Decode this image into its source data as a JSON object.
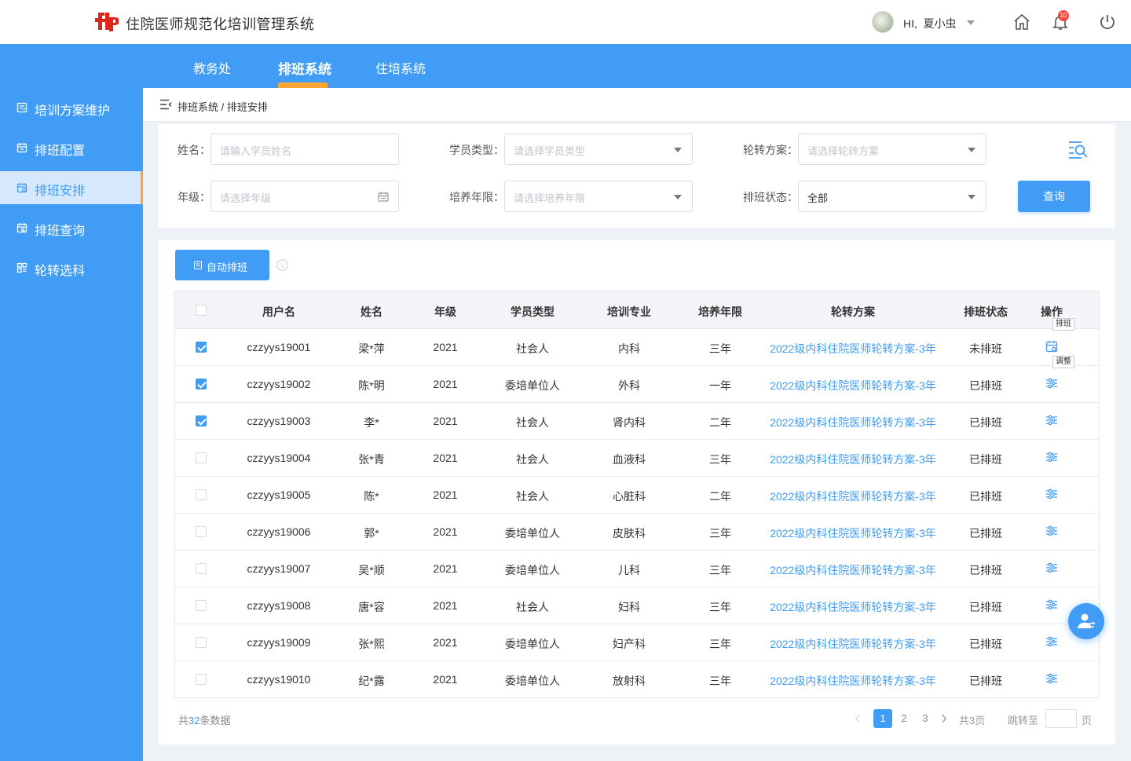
{
  "header": {
    "app_title": "住院医师规范化培训管理系统",
    "greeting": "HI,",
    "username": "夏小虫",
    "notification_count": "10"
  },
  "top_nav": [
    {
      "label": "教务处",
      "active": false
    },
    {
      "label": "排班系统",
      "active": true
    },
    {
      "label": "住培系统",
      "active": false
    }
  ],
  "sidebar": [
    {
      "label": "培训方案维护",
      "icon": "document-icon",
      "active": false
    },
    {
      "label": "排班配置",
      "icon": "calendar-config-icon",
      "active": false
    },
    {
      "label": "排班安排",
      "icon": "calendar-icon",
      "active": true
    },
    {
      "label": "排班查询",
      "icon": "calendar-search-icon",
      "active": false
    },
    {
      "label": "轮转选科",
      "icon": "grid-icon",
      "active": false
    }
  ],
  "breadcrumb": "排班系统 / 排班安排",
  "filters": {
    "name": {
      "label": "姓名：",
      "placeholder": "请输入学员姓名"
    },
    "student_type": {
      "label": "学员类型：",
      "placeholder": "请选择学员类型"
    },
    "rotation_plan": {
      "label": "轮转方案：",
      "placeholder": "请选择轮转方案"
    },
    "grade": {
      "label": "年级：",
      "placeholder": "请选择年级"
    },
    "training_years": {
      "label": "培养年限：",
      "placeholder": "请选择培养年限"
    },
    "schedule_status": {
      "label": "排班状态：",
      "value": "全部"
    },
    "query_label": "查询"
  },
  "toolbar": {
    "auto_schedule_label": "自动排班"
  },
  "table": {
    "columns": [
      "用户名",
      "姓名",
      "年级",
      "学员类型",
      "培训专业",
      "培养年限",
      "轮转方案",
      "排班状态",
      "操作"
    ],
    "rows": [
      {
        "checked": true,
        "username": "czzyys19001",
        "name": "梁*萍",
        "grade": "2021",
        "type": "社会人",
        "major": "内科",
        "years": "三年",
        "plan": "2022级内科住院医师轮转方案-3年",
        "status": "未排班",
        "action": "schedule"
      },
      {
        "checked": true,
        "username": "czzyys19002",
        "name": "陈*明",
        "grade": "2021",
        "type": "委培单位人",
        "major": "外科",
        "years": "一年",
        "plan": "2022级内科住院医师轮转方案-3年",
        "status": "已排班",
        "action": "adjust"
      },
      {
        "checked": true,
        "username": "czzyys19003",
        "name": "李*",
        "grade": "2021",
        "type": "社会人",
        "major": "肾内科",
        "years": "二年",
        "plan": "2022级内科住院医师轮转方案-3年",
        "status": "已排班",
        "action": "adjust"
      },
      {
        "checked": false,
        "username": "czzyys19004",
        "name": "张*青",
        "grade": "2021",
        "type": "社会人",
        "major": "血液科",
        "years": "三年",
        "plan": "2022级内科住院医师轮转方案-3年",
        "status": "已排班",
        "action": "adjust"
      },
      {
        "checked": false,
        "username": "czzyys19005",
        "name": "陈*",
        "grade": "2021",
        "type": "社会人",
        "major": "心脏科",
        "years": "二年",
        "plan": "2022级内科住院医师轮转方案-3年",
        "status": "已排班",
        "action": "adjust"
      },
      {
        "checked": false,
        "username": "czzyys19006",
        "name": "郭*",
        "grade": "2021",
        "type": "委培单位人",
        "major": "皮肤科",
        "years": "三年",
        "plan": "2022级内科住院医师轮转方案-3年",
        "status": "已排班",
        "action": "adjust"
      },
      {
        "checked": false,
        "username": "czzyys19007",
        "name": "吴*顺",
        "grade": "2021",
        "type": "委培单位人",
        "major": "儿科",
        "years": "三年",
        "plan": "2022级内科住院医师轮转方案-3年",
        "status": "已排班",
        "action": "adjust"
      },
      {
        "checked": false,
        "username": "czzyys19008",
        "name": "唐*容",
        "grade": "2021",
        "type": "社会人",
        "major": "妇科",
        "years": "三年",
        "plan": "2022级内科住院医师轮转方案-3年",
        "status": "已排班",
        "action": "adjust"
      },
      {
        "checked": false,
        "username": "czzyys19009",
        "name": "张*熙",
        "grade": "2021",
        "type": "委培单位人",
        "major": "妇产科",
        "years": "三年",
        "plan": "2022级内科住院医师轮转方案-3年",
        "status": "已排班",
        "action": "adjust"
      },
      {
        "checked": false,
        "username": "czzyys19010",
        "name": "纪*露",
        "grade": "2021",
        "type": "委培单位人",
        "major": "放射科",
        "years": "三年",
        "plan": "2022级内科住院医师轮转方案-3年",
        "status": "已排班",
        "action": "adjust"
      }
    ],
    "tooltip_schedule": "排班",
    "tooltip_adjust": "调整"
  },
  "footer": {
    "total_prefix": "共",
    "total_count": "32",
    "total_suffix": "条数据",
    "pages": [
      "1",
      "2",
      "3"
    ],
    "current_page": "1",
    "page_total": "共3页",
    "jump_label": "跳转至",
    "page_unit": "页"
  },
  "colors": {
    "primary": "#409cf4",
    "accent": "#f7a535",
    "badge": "#f5483b"
  }
}
